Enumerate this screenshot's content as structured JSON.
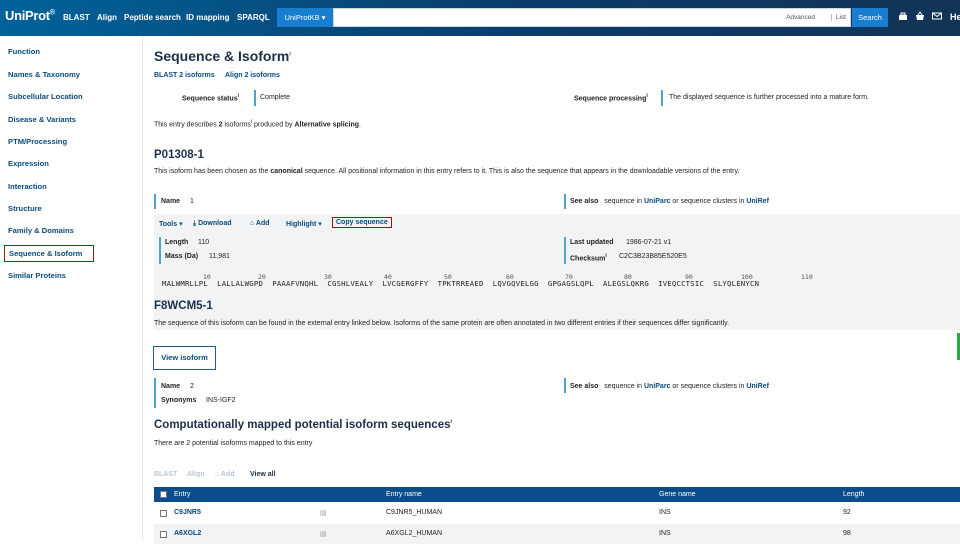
{
  "topbar": {
    "logo": "UniProt",
    "nav": [
      "BLAST",
      "Align",
      "Peptide search",
      "ID mapping",
      "SPARQL"
    ],
    "db_select": "UniProtKB ▾",
    "search_placeholder": "",
    "advanced": "Advanced",
    "list": "List",
    "search_button": "Search",
    "help": "He"
  },
  "sidebar": {
    "items": [
      "Function",
      "Names & Taxonomy",
      "Subcellular Location",
      "Disease & Variants",
      "PTM/Processing",
      "Expression",
      "Interaction",
      "Structure",
      "Family & Domains",
      "Sequence & Isoform",
      "Similar Proteins"
    ],
    "active": "Sequence & Isoform"
  },
  "section": {
    "title": "Sequence & Isoform",
    "info_mark": "i",
    "links": [
      "BLAST 2 isoforms",
      "Align 2 isoforms"
    ],
    "status_label": "Sequence status",
    "status_value": "Complete",
    "processing_label": "Sequence processing",
    "processing_value": "The displayed sequence is further processed into a mature form.",
    "entry_desc_pre": "This entry describes",
    "entry_desc_count": "2",
    "entry_desc_mid": "isoforms",
    "entry_desc_post": "produced by",
    "entry_desc_mech": "Alternative splicing",
    "entry_desc_end": "."
  },
  "iso1": {
    "id": "P01308-1",
    "desc_pre": "This isoform has been chosen as the",
    "desc_bold": "canonical",
    "desc_post": "sequence. All positional information in this entry refers to it. This is also the sequence that appears in the downloadable versions of the entry.",
    "name_label": "Name",
    "name_value": "1",
    "see_also_label": "See also",
    "see_also_pre": "sequence in",
    "see_also_link1": "UniParc",
    "see_also_mid": "or sequence clusters in",
    "see_also_link2": "UniRef",
    "toolbar": [
      "Tools ▾",
      "Download",
      "Add",
      "Highlight ▾",
      "Copy sequence"
    ],
    "length_label": "Length",
    "length_value": "110",
    "mass_label": "Mass (Da)",
    "mass_value": "11,981",
    "updated_label": "Last updated",
    "updated_value": "1986-07-21 v1",
    "checksum_label": "Checksum",
    "checksum_value": "C2C3B23B85E520E5",
    "sequence_blocks": [
      "MALWMRLLPL",
      "LALLALWGPD",
      "PAAAFVNQHL",
      "CGSHLVEALY",
      "LVCGERGFFY",
      "TPKTRREAED",
      "LQVGQVELGG",
      "GPGAGSLQPL",
      "ALEGSLQKRG",
      "IVEQCCTSIC",
      "SLYQLENYCN"
    ],
    "ticks": [
      "10",
      "20",
      "30",
      "40",
      "50",
      "60",
      "70",
      "80",
      "90",
      "100",
      "110"
    ]
  },
  "iso2": {
    "id": "F8WCM5-1",
    "desc": "The sequence of this isoform can be found in the external entry linked below. Isoforms of the same protein are often annotated in two different entries if their sequences differ significantly.",
    "view_button": "View isoform",
    "name_label": "Name",
    "name_value": "2",
    "synonyms_label": "Synonyms",
    "synonyms_value": "INS-IGF2",
    "see_also_label": "See also",
    "see_also_pre": "sequence in",
    "see_also_link1": "UniParc",
    "see_also_mid": "or sequence clusters in",
    "see_also_link2": "UniRef"
  },
  "computed": {
    "title": "Computationally mapped potential isoform sequences",
    "desc": "There are 2 potential isoforms mapped to this entry",
    "toolbar": [
      "BLAST",
      "Align",
      "Add",
      "View all"
    ],
    "columns": [
      "Entry",
      "Entry name",
      "Gene name",
      "Length"
    ],
    "rows": [
      {
        "entry": "C9JNR5",
        "entry_name": "C9JNR5_HUMAN",
        "gene": "INS",
        "length": "92"
      },
      {
        "entry": "A6XGL2",
        "entry_name": "A6XGL2_HUMAN",
        "gene": "INS",
        "length": "98"
      }
    ]
  }
}
